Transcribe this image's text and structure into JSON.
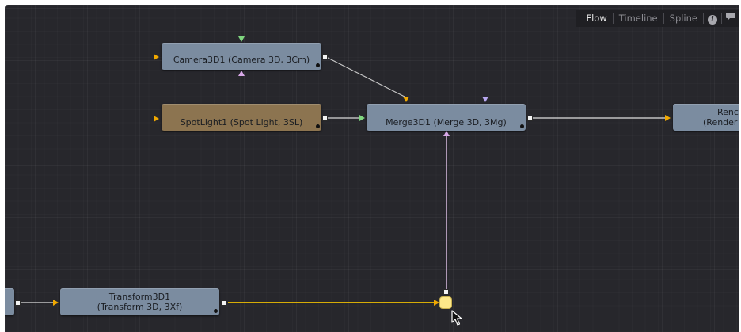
{
  "tabs": {
    "flow": "Flow",
    "timeline": "Timeline",
    "spline": "Spline",
    "info_icon": "info-icon",
    "comment_icon": "comment-icon"
  },
  "nodes": {
    "camera": "Camera3D1  (Camera 3D, 3Cm)",
    "spotlight": "SpotLight1  (Spot Light, 3SL)",
    "merge": "Merge3D1  (Merge 3D, 3Mg)",
    "render_line1": "Renc",
    "render_line2": "(Render",
    "transform_line1": "Transform3D1",
    "transform_line2": "(Transform 3D, 3Xf)"
  },
  "colors": {
    "background": "#27272c",
    "node": "#7b8ca0",
    "spotlight_node": "#8c7450",
    "active_wire": "#f0c000",
    "selected_knot": "#fde88a"
  }
}
